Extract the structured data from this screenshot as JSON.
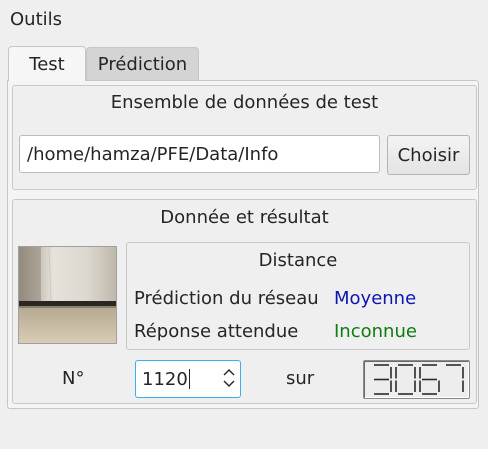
{
  "window": {
    "title": "Outils"
  },
  "tabs": [
    {
      "label": "Test",
      "active": true
    },
    {
      "label": "Prédiction",
      "active": false
    }
  ],
  "test_set": {
    "title": "Ensemble de données de test",
    "path_value": "/home/hamza/PFE/Data/Info",
    "choose_label": "Choisir"
  },
  "result": {
    "title": "Donnée et résultat",
    "image_icon": "floor-photo",
    "category_title": "Distance",
    "prediction_label": "Prédiction du réseau",
    "prediction_value": "Moyenne",
    "expected_label": "Réponse attendue",
    "expected_value": "Inconnue",
    "index_label": "N°",
    "index_value": "1120",
    "of_label": "sur",
    "total_value": "3067"
  },
  "colors": {
    "prediction": "#0f14b4",
    "expected": "#0f7a0f",
    "focus": "#3daee9"
  }
}
